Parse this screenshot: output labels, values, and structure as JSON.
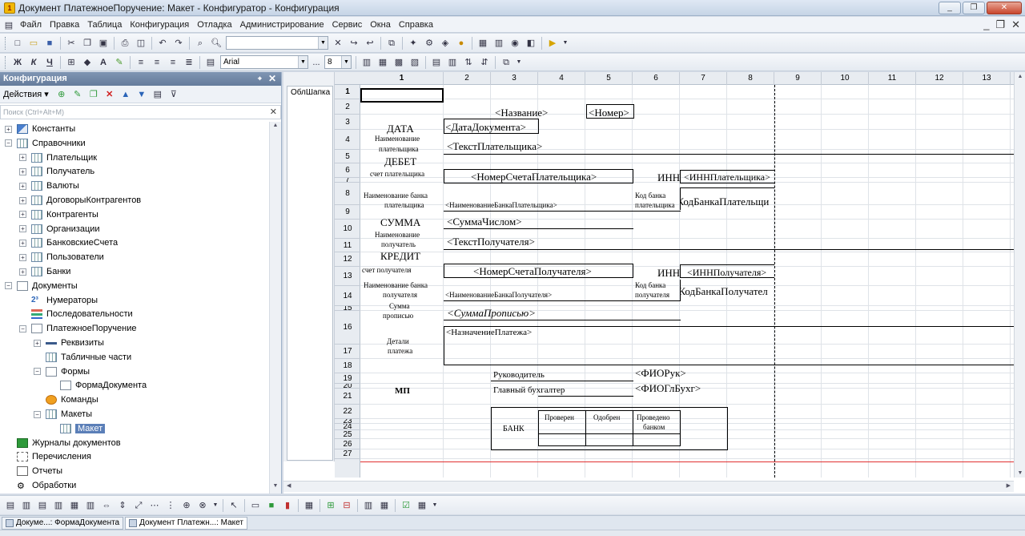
{
  "window": {
    "title": "Документ ПлатежноеПоручение: Макет - Конфигуратор - Конфигурация",
    "minimize": "_",
    "maximize": "❐",
    "close": "✕"
  },
  "menu": [
    "Файл",
    "Правка",
    "Таблица",
    "Конфигурация",
    "Отладка",
    "Администрирование",
    "Сервис",
    "Окна",
    "Справка"
  ],
  "mdi_controls": {
    "minimize": "_",
    "restore": "❐",
    "close": "✕"
  },
  "toolbar2": {
    "bold": "Ж",
    "italic": "К",
    "underline": "Ч",
    "font_name": "Arial",
    "font_more": "...",
    "font_size": "8"
  },
  "sidebar": {
    "title": "Конфигурация",
    "close": "✕",
    "actions_label": "Действия",
    "search_placeholder": "Поиск (Ctrl+Alt+M)",
    "search_clear": "✕",
    "tree": [
      {
        "label": "Константы",
        "level": 0,
        "exp": "+",
        "icon": "const"
      },
      {
        "label": "Справочники",
        "level": 0,
        "exp": "−",
        "icon": "tbl"
      },
      {
        "label": "Плательщик",
        "level": 1,
        "exp": "+",
        "icon": "tbl"
      },
      {
        "label": "Получатель",
        "level": 1,
        "exp": "+",
        "icon": "tbl"
      },
      {
        "label": "Валюты",
        "level": 1,
        "exp": "+",
        "icon": "tbl"
      },
      {
        "label": "ДоговорыКонтрагентов",
        "level": 1,
        "exp": "+",
        "icon": "tbl"
      },
      {
        "label": "Контрагенты",
        "level": 1,
        "exp": "+",
        "icon": "tbl"
      },
      {
        "label": "Организации",
        "level": 1,
        "exp": "+",
        "icon": "tbl"
      },
      {
        "label": "БанковскиеСчета",
        "level": 1,
        "exp": "+",
        "icon": "tbl"
      },
      {
        "label": "Пользователи",
        "level": 1,
        "exp": "+",
        "icon": "tbl"
      },
      {
        "label": "Банки",
        "level": 1,
        "exp": "+",
        "icon": "tbl"
      },
      {
        "label": "Документы",
        "level": 0,
        "exp": "−",
        "icon": "doc"
      },
      {
        "label": "Нумераторы",
        "level": 1,
        "exp": "",
        "icon": "num"
      },
      {
        "label": "Последовательности",
        "level": 1,
        "exp": "",
        "icon": "seq"
      },
      {
        "label": "ПлатежноеПоручение",
        "level": 1,
        "exp": "−",
        "icon": "doc"
      },
      {
        "label": "Реквизиты",
        "level": 2,
        "exp": "+",
        "icon": "attr"
      },
      {
        "label": "Табличные части",
        "level": 2,
        "exp": "",
        "icon": "tbl"
      },
      {
        "label": "Формы",
        "level": 2,
        "exp": "−",
        "icon": "doc"
      },
      {
        "label": "ФормаДокумента",
        "level": 3,
        "exp": "",
        "icon": "doc"
      },
      {
        "label": "Команды",
        "level": 2,
        "exp": "",
        "icon": "cmd"
      },
      {
        "label": "Макеты",
        "level": 2,
        "exp": "−",
        "icon": "tbl"
      },
      {
        "label": "Макет",
        "level": 3,
        "exp": "",
        "icon": "tbl",
        "selected": true
      },
      {
        "label": "Журналы документов",
        "level": 0,
        "exp": "",
        "icon": "jour"
      },
      {
        "label": "Перечисления",
        "level": 0,
        "exp": "",
        "icon": "enum"
      },
      {
        "label": "Отчеты",
        "level": 0,
        "exp": "",
        "icon": "rep"
      },
      {
        "label": "Обработки",
        "level": 0,
        "exp": "",
        "icon": "proc"
      }
    ]
  },
  "sheet": {
    "area_name": "ОблШапка",
    "columns": [
      "1",
      "2",
      "3",
      "4",
      "5",
      "6",
      "7",
      "8",
      "9",
      "10",
      "11",
      "12",
      "13"
    ],
    "rows": [
      "1",
      "2",
      "3",
      "4",
      "5",
      "6",
      "7",
      "8",
      "9",
      "10",
      "11",
      "12",
      "13",
      "14",
      "15",
      "16",
      "17",
      "18",
      "19",
      "20",
      "21",
      "22",
      "23",
      "24",
      "25",
      "26",
      "27"
    ],
    "cells": {
      "name": "<Название>",
      "number": "<Номер>",
      "date_label": "ДАТА",
      "date_value": "<ДатаДокумента>",
      "payer_name_label": [
        "Наименование",
        "плательщика"
      ],
      "payer_text": "<ТекстПлательщика>",
      "debit": "ДЕБЕТ",
      "payer_account_label": "счет плательщика",
      "payer_account": "<НомерСчетаПлательщика>",
      "inn": "ИНН",
      "payer_inn": "<ИННПлательщика>",
      "payer_bank_label": [
        "Наименование банка",
        "плательщика"
      ],
      "payer_bank": "<НаименованиеБанкаПлательщика>",
      "bank_code_label": [
        "Код банка",
        "плательщика"
      ],
      "payer_bank_code": "<КодБанкаПлательщи",
      "sum_label": "СУММА",
      "sum_value": "<СуммаЧислом>",
      "recipient_name_label": [
        "Наименование",
        "получатель"
      ],
      "recipient_text": "<ТекстПолучателя>",
      "credit": "КРЕДИТ",
      "recipient_account_label": "счет получателя",
      "recipient_account": "<НомерСчетаПолучателя>",
      "inn2": "ИНН",
      "recipient_inn": "<ИННПолучателя>",
      "recipient_bank_label": [
        "Наименование банка",
        "получателя"
      ],
      "recipient_bank": "<НаименованиеБанкаПолучателя>",
      "recipient_bank_code_label": [
        "Код банка",
        "получателя"
      ],
      "recipient_bank_code": "<КодБанкаПолучател",
      "sum_words_label": [
        "Сумма",
        "прописью"
      ],
      "sum_words": "<СуммаПрописью>",
      "details_label": [
        "Детали",
        "платежа"
      ],
      "details": "<НазначениеПлатежа>",
      "head_label": "Руководитель",
      "head_value": "<ФИОРук>",
      "mp": "МП",
      "accountant_label": "Главный бухгалтер",
      "accountant_value": "<ФИОГлБухг>",
      "bank": "БАНК",
      "checked": "Проверен",
      "approved": "Одобрен",
      "processed": [
        "Проведено",
        "банком"
      ]
    }
  },
  "taskbar": [
    {
      "label": "Докуме...: ФормаДокумента",
      "active": false
    },
    {
      "label": "Документ Платежн...: Макет",
      "active": true
    }
  ]
}
